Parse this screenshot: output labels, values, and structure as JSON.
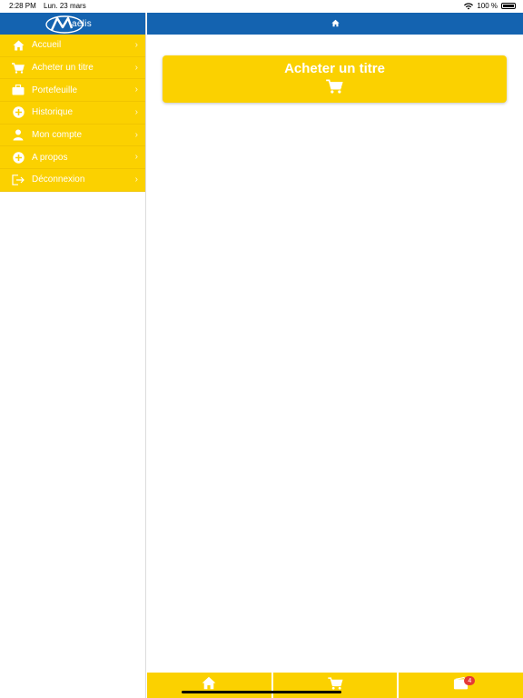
{
  "status_bar": {
    "time": "2:28 PM",
    "date": "Lun. 23 mars",
    "battery": "100 %"
  },
  "sidebar": {
    "logo_text": "aelis",
    "items": [
      {
        "label": "Accueil",
        "icon": "home-icon"
      },
      {
        "label": "Acheter un titre",
        "icon": "cart-icon"
      },
      {
        "label": "Portefeuille",
        "icon": "briefcase-icon"
      },
      {
        "label": "Historique",
        "icon": "plus-circle-icon"
      },
      {
        "label": "Mon compte",
        "icon": "user-icon"
      },
      {
        "label": "A propos",
        "icon": "plus-circle-icon"
      },
      {
        "label": "Déconnexion",
        "icon": "logout-icon"
      }
    ]
  },
  "main": {
    "header_icon": "home-icon",
    "card": {
      "title": "Acheter un titre",
      "icon": "cart-icon"
    }
  },
  "tabbar": {
    "tabs": [
      {
        "icon": "home-icon"
      },
      {
        "icon": "cart-icon"
      },
      {
        "icon": "wallet-icon",
        "badge": "4"
      }
    ]
  },
  "colors": {
    "blue": "#1463b0",
    "yellow": "#fbd100",
    "badge": "#e53935"
  }
}
